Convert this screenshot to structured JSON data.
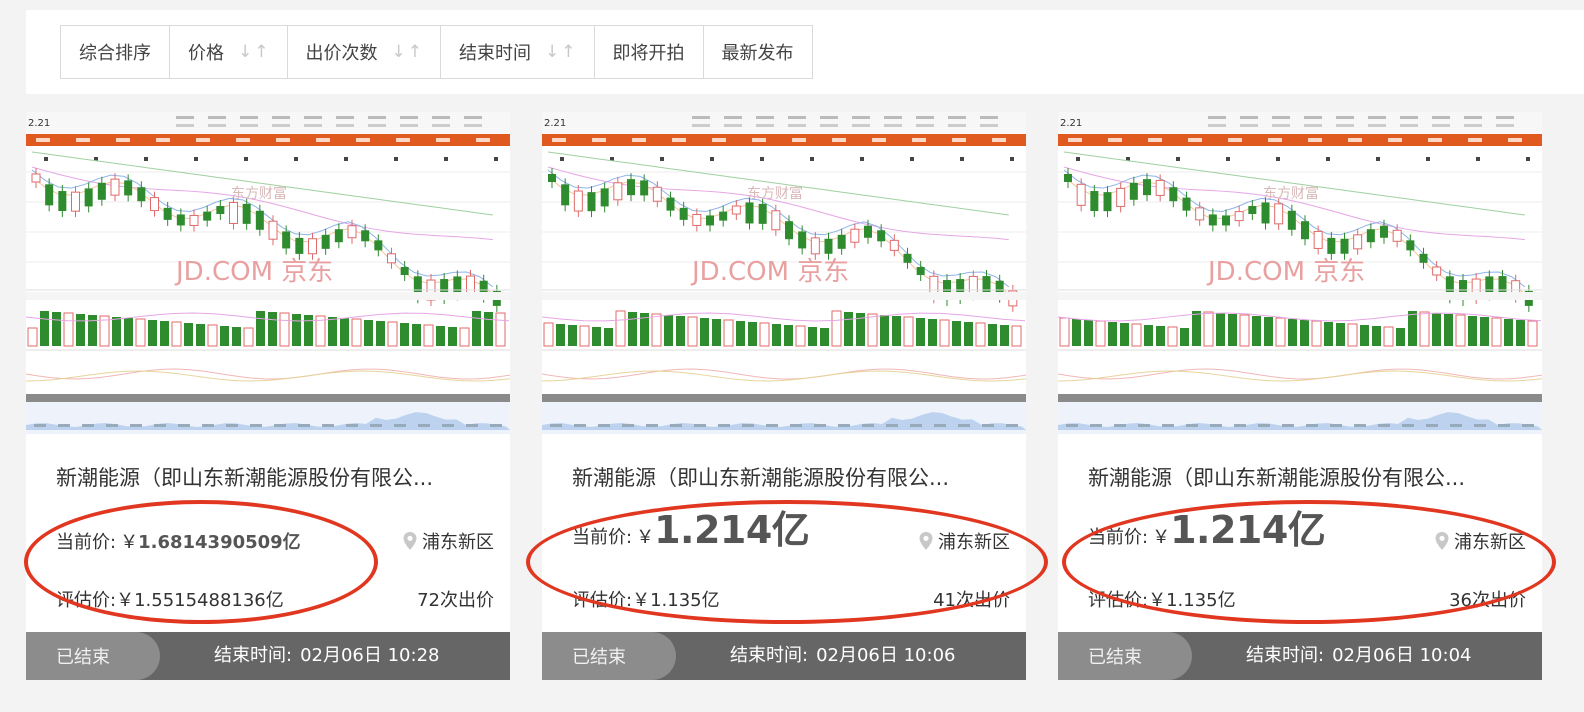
{
  "sort_tabs": [
    {
      "label": "综合排序",
      "has_arrows": false
    },
    {
      "label": "价格",
      "has_arrows": true
    },
    {
      "label": "出价次数",
      "has_arrows": true
    },
    {
      "label": "结束时间",
      "has_arrows": true
    },
    {
      "label": "即将开拍",
      "has_arrows": false
    },
    {
      "label": "最新发布",
      "has_arrows": false
    }
  ],
  "colors": {
    "accent_red": "#e1361f",
    "footer_bg": "#666666",
    "status_pill": "#8c8c8c",
    "chart_orange": "#e05a1f",
    "candle_green": "#2e8b2e",
    "candle_red": "#e06a6a"
  },
  "icons": {
    "location": "map-pin-icon",
    "sort": "sort-arrows-icon"
  },
  "cards": [
    {
      "title": "新潮能源（即山东新潮能源股份有限公...",
      "thumb_watermark": "JD.COM 京东",
      "thumb_price": "2.21",
      "price_label": "当前价:",
      "currency": "￥",
      "price": "1.6814390509亿",
      "price_size": "small",
      "location": "浦东新区",
      "estimate": "评估价:￥1.5515488136亿",
      "bids": "72次出价",
      "status": "已结束",
      "end_label": "结束时间:",
      "end_time": "02月06日 10:28"
    },
    {
      "title": "新潮能源（即山东新潮能源股份有限公...",
      "thumb_watermark": "JD.COM 京东",
      "thumb_price": "2.21",
      "price_label": "当前价:",
      "currency": "￥",
      "price": "1.214亿",
      "price_size": "big",
      "location": "浦东新区",
      "estimate": "评估价:￥1.135亿",
      "bids": "41次出价",
      "status": "已结束",
      "end_label": "结束时间:",
      "end_time": "02月06日 10:06"
    },
    {
      "title": "新潮能源（即山东新潮能源股份有限公...",
      "thumb_watermark": "JD.COM 京东",
      "thumb_price": "2.21",
      "price_label": "当前价:",
      "currency": "￥",
      "price": "1.214亿",
      "price_size": "big",
      "location": "浦东新区",
      "estimate": "评估价:￥1.135亿",
      "bids": "36次出价",
      "status": "已结束",
      "end_label": "结束时间:",
      "end_time": "02月06日 10:04"
    }
  ]
}
